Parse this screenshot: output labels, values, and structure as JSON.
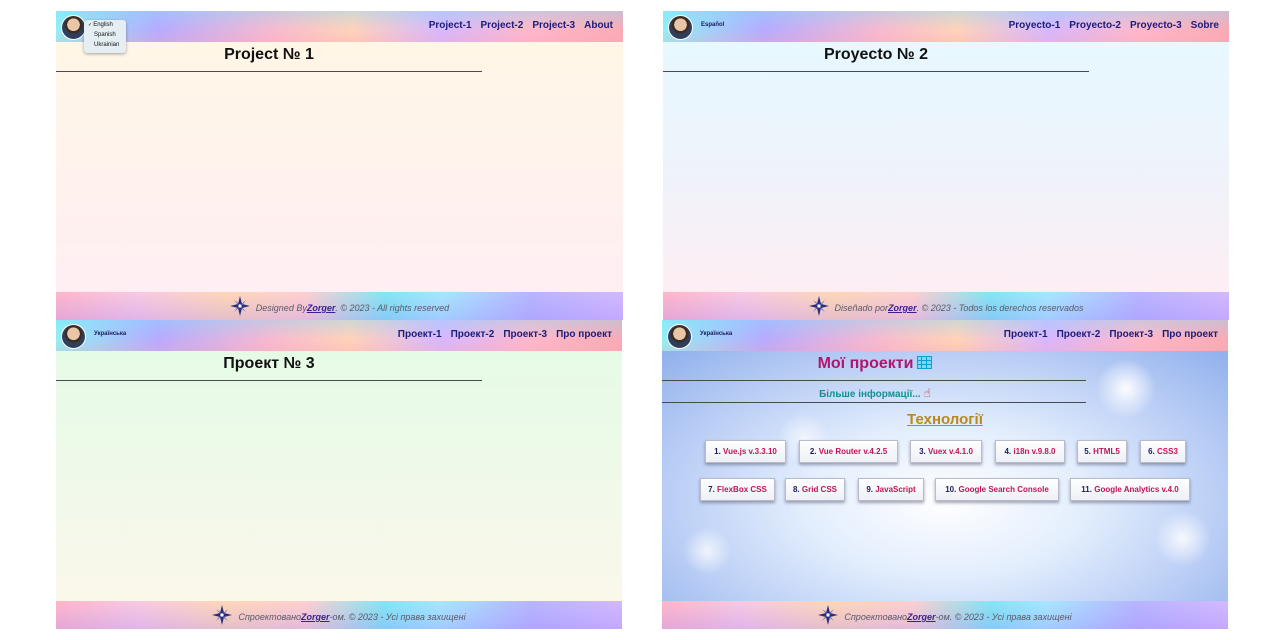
{
  "panels": [
    {
      "lang_label": "",
      "nav": [
        "Project-1",
        "Project-2",
        "Project-3",
        "About"
      ],
      "title": "Project № 1",
      "footer": {
        "prefix": "Designed By ",
        "author": "Zorger",
        "suffix": ". © 2023 - All rights reserved"
      }
    },
    {
      "lang_label": "Español",
      "nav": [
        "Proyecto-1",
        "Proyecto-2",
        "Proyecto-3",
        "Sobre"
      ],
      "title": "Proyecto № 2",
      "footer": {
        "prefix": "Diseñado por ",
        "author": "Zorger",
        "suffix": ". © 2023 - Todos los derechos reservados"
      }
    },
    {
      "lang_label": "Українська",
      "nav": [
        "Проект-1",
        "Проект-2",
        "Проект-3",
        "Про проект"
      ],
      "title": "Проект № 3",
      "footer": {
        "prefix": "Спроектовано ",
        "author": "Zorger",
        "suffix": "-ом. © 2023 - Усі права захищені"
      }
    },
    {
      "lang_label": "Українська",
      "nav": [
        "Проект-1",
        "Проект-2",
        "Проект-3",
        "Про проект"
      ],
      "my_projects": "Мої проекти",
      "more_info": "Більше інформації...",
      "tech_heading": "Технології",
      "tech": [
        {
          "n": "1.",
          "t": "Vue.js v.3.3.10"
        },
        {
          "n": "2.",
          "t": "Vue Router v.4.2.5"
        },
        {
          "n": "3.",
          "t": "Vuex v.4.1.0"
        },
        {
          "n": "4.",
          "t": "i18n v.9.8.0"
        },
        {
          "n": "5.",
          "t": "HTML5"
        },
        {
          "n": "6.",
          "t": "CSS3"
        },
        {
          "n": "7.",
          "t": "FlexBox CSS"
        },
        {
          "n": "8.",
          "t": "Grid CSS"
        },
        {
          "n": "9.",
          "t": "JavaScript"
        },
        {
          "n": "10.",
          "t": "Google Search Console"
        },
        {
          "n": "11.",
          "t": "Google Analytics v.4.0"
        }
      ],
      "footer": {
        "prefix": "Спроектовано ",
        "author": "Zorger",
        "suffix": "-ом. © 2023 - Усі права захищені"
      }
    }
  ],
  "language_menu": {
    "options": [
      "English",
      "Spanish",
      "Ukrainian"
    ],
    "selected": "English"
  },
  "colors": {
    "nav_text": "#1c1c7a",
    "my_projects": "#b0166f",
    "more_info": "#168f8f",
    "tech_heading": "#b88a18",
    "tech_item": "#c2135a"
  },
  "icons": {
    "avatar": "user-photo",
    "footer_logo": "compass-star-icon",
    "my_projects": "table-icon",
    "more_info": "pointing-hand-icon"
  }
}
